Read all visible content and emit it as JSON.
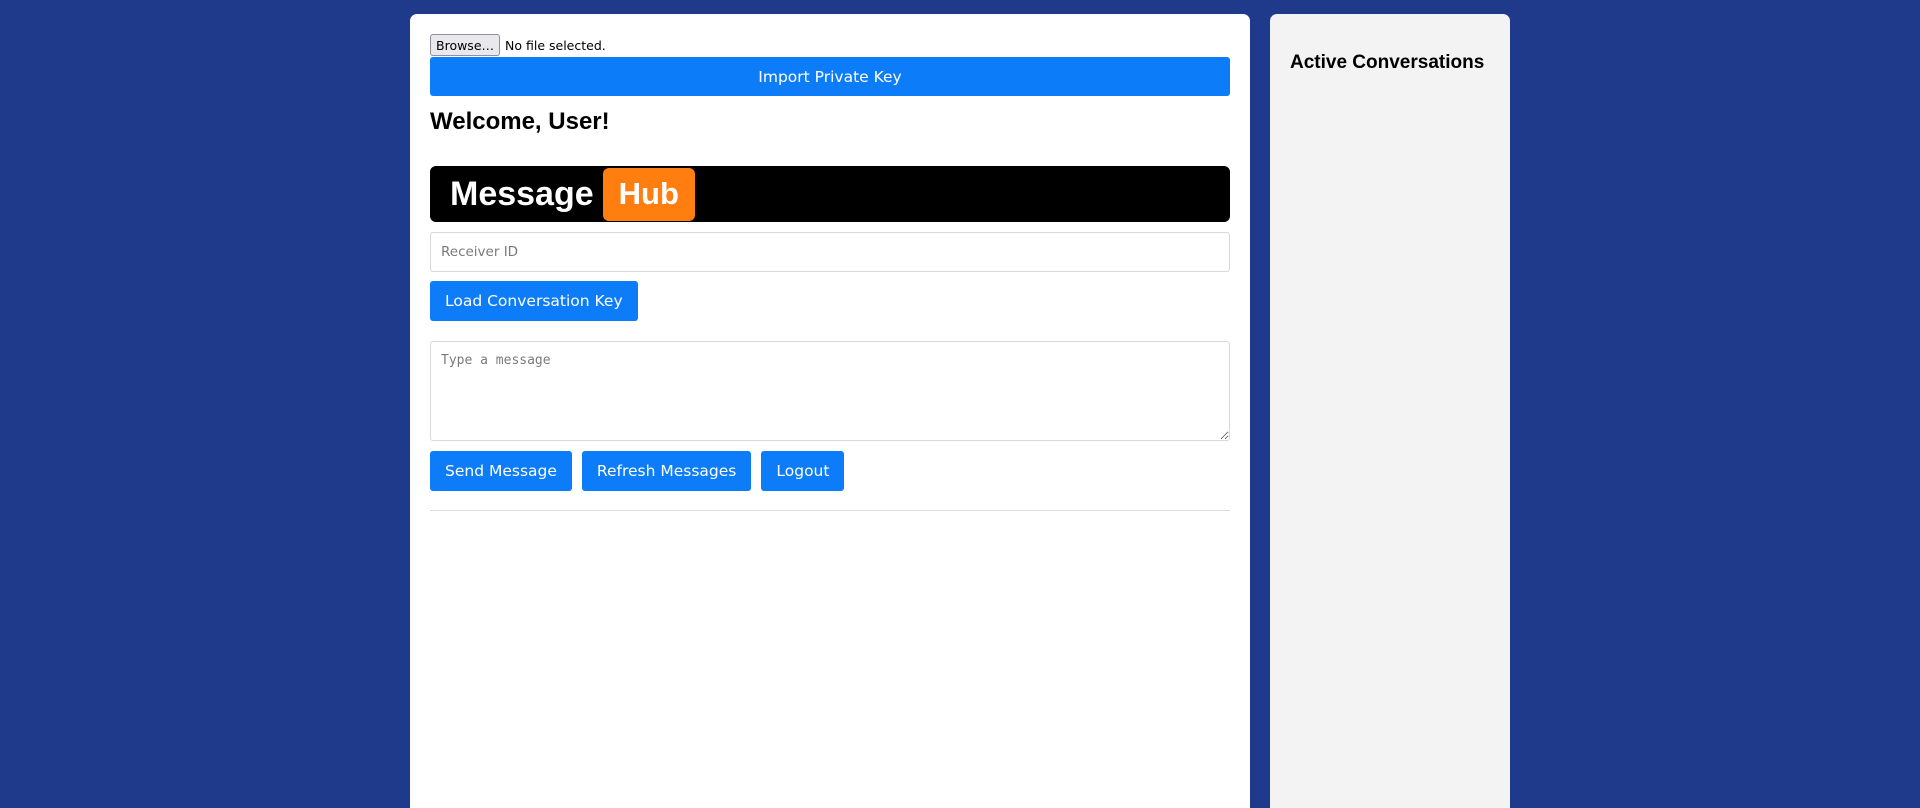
{
  "colors": {
    "page_background": "#1f3a8a",
    "primary_button": "#0d7cf8",
    "banner_background": "#000000",
    "banner_accent": "#ff7e0f",
    "sidebar_background": "#f3f3f3"
  },
  "file_picker": {
    "browse_label": "Browse…",
    "status": "No file selected."
  },
  "import_button": {
    "label": "Import Private Key"
  },
  "welcome": {
    "text": "Welcome, User!"
  },
  "brand": {
    "word1": "Message",
    "word2": "Hub"
  },
  "receiver": {
    "placeholder": "Receiver ID",
    "value": ""
  },
  "load_key_button": {
    "label": "Load Conversation Key"
  },
  "message": {
    "placeholder": "Type a message",
    "value": ""
  },
  "actions": {
    "send_label": "Send Message",
    "refresh_label": "Refresh Messages",
    "logout_label": "Logout"
  },
  "sidebar": {
    "title": "Active Conversations"
  }
}
